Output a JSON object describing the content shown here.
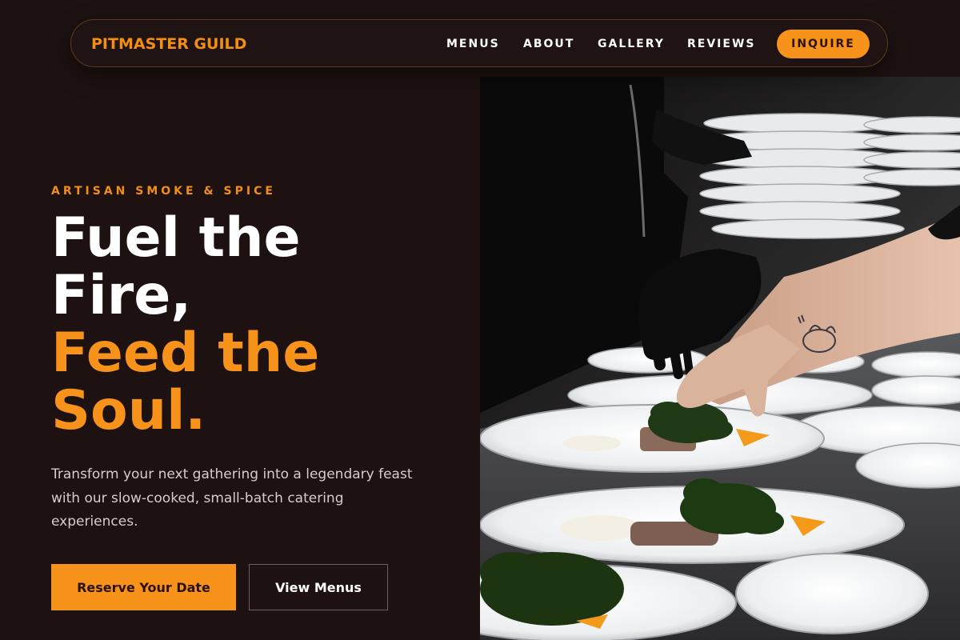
{
  "nav": {
    "brand": "PITMASTER GUILD",
    "links": [
      "MENUS",
      "ABOUT",
      "GALLERY",
      "REVIEWS"
    ],
    "cta": "INQUIRE"
  },
  "hero": {
    "kicker": "ARTISAN SMOKE & SPICE",
    "headline_white": [
      "Fuel the",
      "Fire,"
    ],
    "headline_orange": [
      "Feed the",
      "Soul."
    ],
    "description": "Transform your next gathering into a legendary feast with our slow-cooked, small-batch catering experiences.",
    "primary_button": "Reserve Your Date",
    "secondary_button": "View Menus"
  },
  "colors": {
    "background": "#1d1211",
    "accent": "#f7921a",
    "text": "#ffffff"
  },
  "image": {
    "subject": "chef in black gloves plating dishes of greens on white plates"
  }
}
